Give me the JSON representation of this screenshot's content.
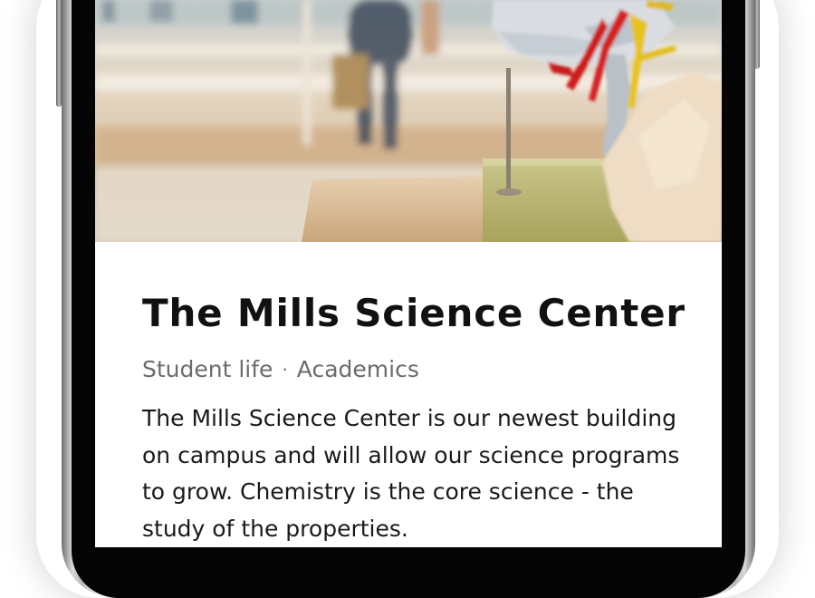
{
  "article": {
    "title": "The Mills Science Center",
    "categories": [
      "Student life",
      "Academics"
    ],
    "separator": "·",
    "body": "The Mills Science Center is our newest building on campus and will allow our science programs to grow. Chemistry is the core science - the study of the properties."
  },
  "hero": {
    "image_subject": "anatomical-skull-model-photo"
  },
  "colors": {
    "title": "#111111",
    "meta": "#6b6b6b",
    "body": "#1a1a1a",
    "screen_bg": "#ffffff",
    "bezel": "#050505"
  }
}
